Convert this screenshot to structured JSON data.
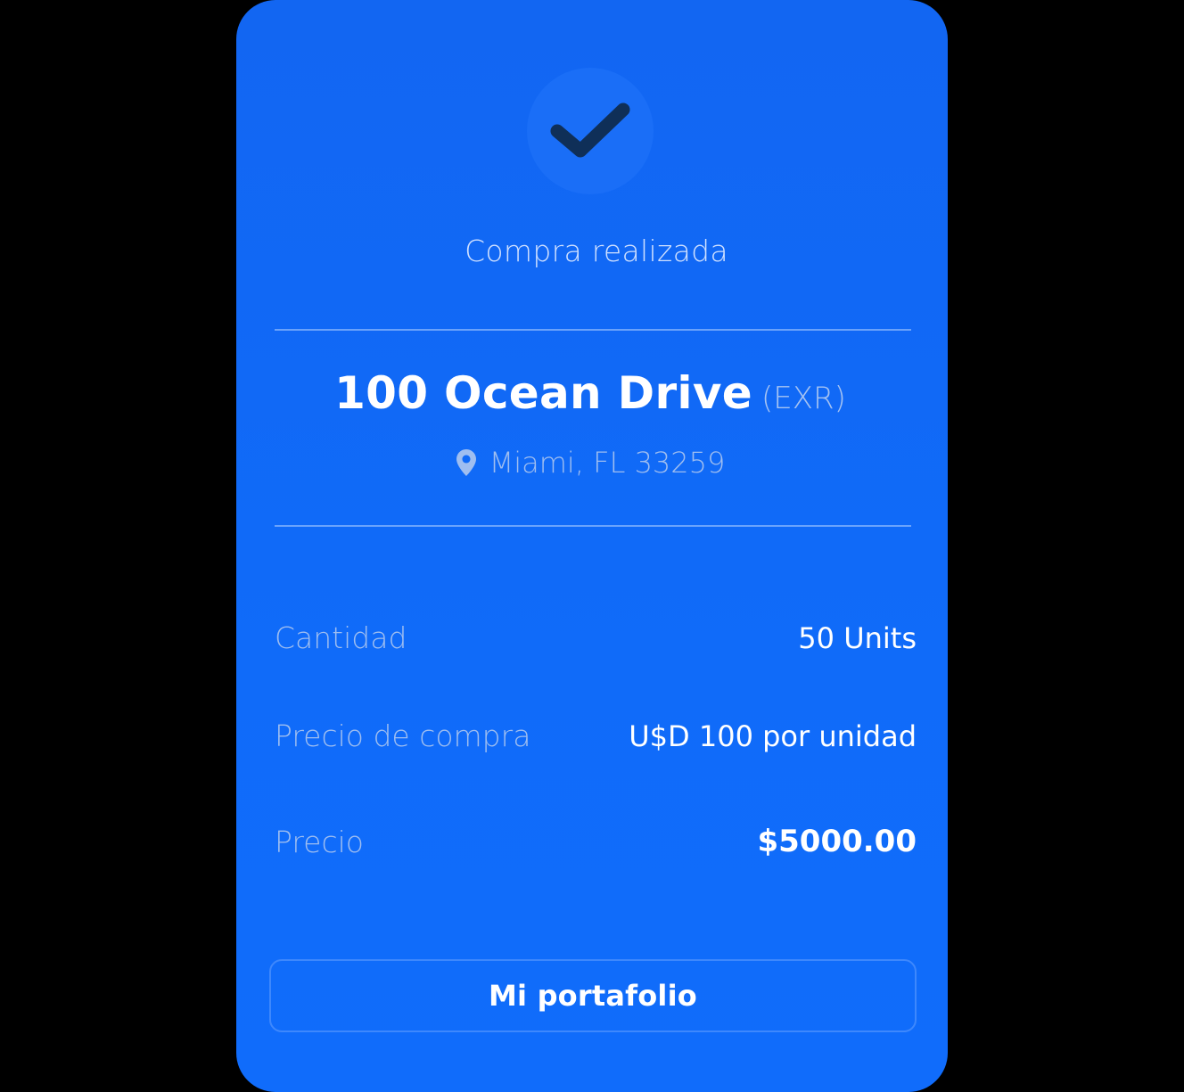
{
  "status": {
    "icon": "check-icon",
    "title": "Compra realizada"
  },
  "property": {
    "name": "100 Ocean Drive",
    "ticker": "(EXR)",
    "location_icon": "map-pin-icon",
    "location": "Miami, FL 33259"
  },
  "details": {
    "quantity_label": "Cantidad",
    "quantity_value": "50 Units",
    "unit_price_label": "Precio de compra",
    "unit_price_value": "U$D 100 por unidad",
    "total_label": "Precio",
    "total_value": "$5000.00"
  },
  "actions": {
    "portfolio_label": "Mi portafolio"
  },
  "colors": {
    "card_background": "#106bf9",
    "check": "#0f2f58",
    "muted_text": "#9fbef0",
    "page_background": "#000000"
  }
}
